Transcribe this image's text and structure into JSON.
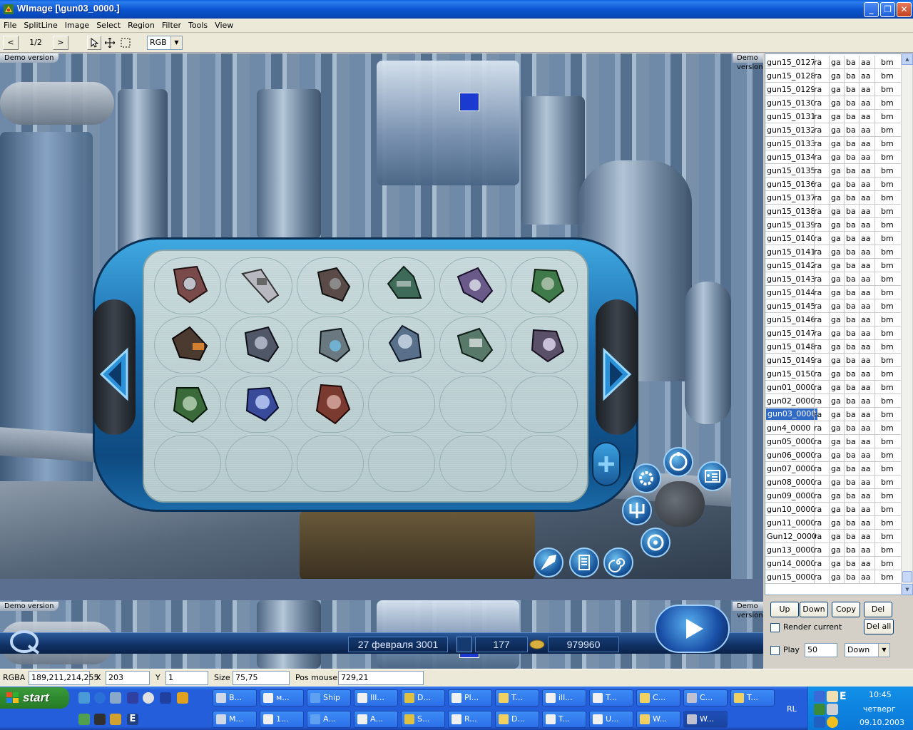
{
  "window": {
    "title": "WImage [\\gun03_0000.]",
    "min": "_",
    "max": "❐",
    "close": "✕"
  },
  "menu": [
    "File",
    "SplitLine",
    "Image",
    "Select",
    "Region",
    "Filter",
    "Tools",
    "View"
  ],
  "toolbar": {
    "prev": "<",
    "page": "1/2",
    "next": ">",
    "mode_value": "RGB"
  },
  "view": {
    "demo_label": "Demo version",
    "hud": {
      "date": "27 февраля 3001",
      "count": "177",
      "money": "979960"
    }
  },
  "list": {
    "rows": [
      {
        "name": "gun15_0127"
      },
      {
        "name": "gun15_0128"
      },
      {
        "name": "gun15_0129"
      },
      {
        "name": "gun15_0130"
      },
      {
        "name": "gun15_0131"
      },
      {
        "name": "gun15_0132"
      },
      {
        "name": "gun15_0133"
      },
      {
        "name": "gun15_0134"
      },
      {
        "name": "gun15_0135"
      },
      {
        "name": "gun15_0136"
      },
      {
        "name": "gun15_0137"
      },
      {
        "name": "gun15_0138"
      },
      {
        "name": "gun15_0139"
      },
      {
        "name": "gun15_0140"
      },
      {
        "name": "gun15_0141"
      },
      {
        "name": "gun15_0142"
      },
      {
        "name": "gun15_0143"
      },
      {
        "name": "gun15_0144"
      },
      {
        "name": "gun15_0145"
      },
      {
        "name": "gun15_0146"
      },
      {
        "name": "gun15_0147"
      },
      {
        "name": "gun15_0148"
      },
      {
        "name": "gun15_0149"
      },
      {
        "name": "gun15_0150"
      },
      {
        "name": "gun01_0000"
      },
      {
        "name": "gun02_0000"
      },
      {
        "name": "gun03_0000",
        "selected": true
      },
      {
        "name": "gun4_0000"
      },
      {
        "name": "gun05_0000"
      },
      {
        "name": "gun06_0000"
      },
      {
        "name": "gun07_0000"
      },
      {
        "name": "gun08_0000"
      },
      {
        "name": "gun09_0000"
      },
      {
        "name": "gun10_0000"
      },
      {
        "name": "gun11_0000"
      },
      {
        "name": "Gun12_0000"
      },
      {
        "name": "gun13_0000"
      },
      {
        "name": "gun14_0000"
      },
      {
        "name": "gun15_0000"
      }
    ],
    "cols": [
      "ra",
      "ga",
      "ba",
      "aa",
      "bm"
    ]
  },
  "controls": {
    "up": "Up",
    "down": "Down",
    "copy": "Copy",
    "del": "Del",
    "render_current": "Render current",
    "del_all": "Del all",
    "play": "Play",
    "play_value": "50",
    "direction_value": "Down"
  },
  "status": {
    "rgba_label": "RGBA",
    "rgba_value": "189,211,214,255",
    "x_label": "X",
    "x_value": "203",
    "y_label": "Y",
    "y_value": "1",
    "size_label": "Size",
    "size_value": "75,75",
    "pos_label": "Pos mouse:",
    "pos_value": "729,21"
  },
  "taskbar": {
    "start": "start",
    "tasks_row1": [
      "B...",
      "м...",
      "Ship",
      "Ill...",
      "D...",
      "Pl...",
      "T...",
      "ill...",
      "T...",
      "C...",
      "C...",
      "T..."
    ],
    "tasks_row2": [
      "M...",
      "1...",
      "A...",
      "A...",
      "S...",
      "R...",
      "D...",
      "T...",
      "U...",
      "W...",
      "W..."
    ],
    "lang": "RL",
    "time": "10:45",
    "day": "четверг",
    "date": "09.10.2003"
  },
  "colors": {
    "titlebar": "#0a55d0",
    "selection": "#316ac5",
    "taskbar": "#245edb",
    "start": "#2f8a2f"
  }
}
